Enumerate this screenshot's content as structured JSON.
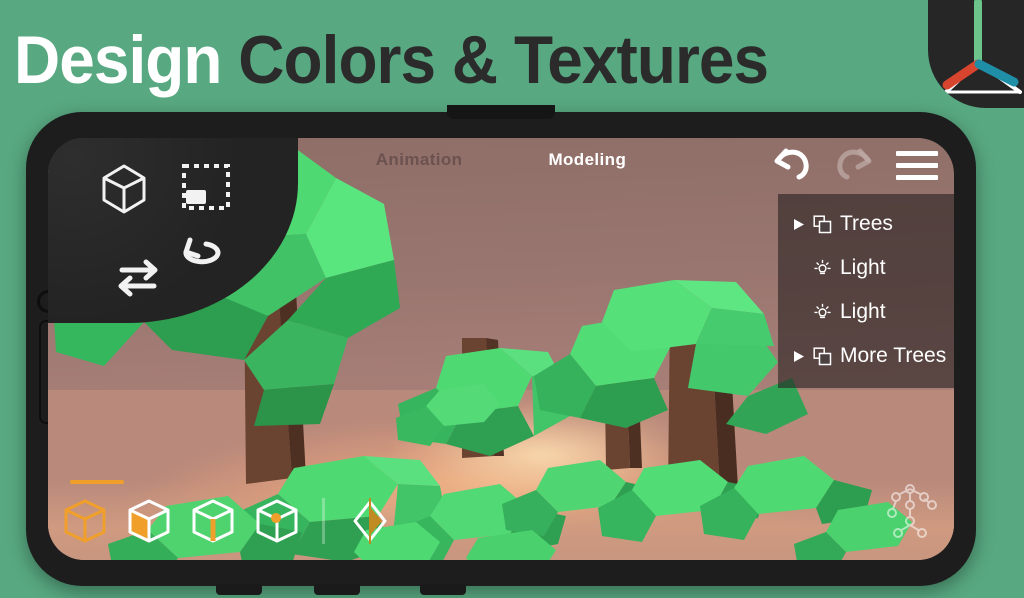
{
  "banner": {
    "title_light": "Design ",
    "title_dark": "Colors & Textures",
    "background_color": "#58a881",
    "title_light_color": "#ffffff",
    "title_dark_color": "#2b2b2b"
  },
  "corner_logo": {
    "name": "axis-gizmo-logo",
    "background_color": "#262626",
    "axis_up_color": "#6cc48a",
    "axis_left_color": "#d8452e",
    "axis_right_color": "#1f8fa8"
  },
  "app": {
    "viewport_tools": [
      {
        "name": "object-mode-cube-icon",
        "label": "Object"
      },
      {
        "name": "marquee-select-icon",
        "label": "Select"
      },
      {
        "name": "rotate-icon",
        "label": "Rotate"
      },
      {
        "name": "move-icon",
        "label": "Move"
      }
    ],
    "tabs": [
      {
        "label": "Animation",
        "active": false
      },
      {
        "label": "Modeling",
        "active": true
      }
    ],
    "top_right": [
      {
        "name": "undo-icon",
        "label": "Undo",
        "enabled": true
      },
      {
        "name": "redo-icon",
        "label": "Redo",
        "enabled": false
      },
      {
        "name": "menu-icon",
        "label": "Menu",
        "enabled": true
      }
    ],
    "outliner": {
      "items": [
        {
          "label": "Trees",
          "icon": "group-icon",
          "expandable": true
        },
        {
          "label": "Light",
          "icon": "light-bulb-icon",
          "expandable": false
        },
        {
          "label": "Light",
          "icon": "light-bulb-icon",
          "expandable": false
        },
        {
          "label": "More Trees",
          "icon": "group-icon",
          "expandable": true
        }
      ],
      "panel_color": "rgba(38,32,32,0.60)"
    },
    "bottom_bar": {
      "accent_color": "#f0a02a",
      "modes": [
        {
          "name": "mode-object",
          "label": "Object",
          "active": true
        },
        {
          "name": "mode-face",
          "label": "Face",
          "active": false
        },
        {
          "name": "mode-edge",
          "label": "Edge",
          "active": false
        },
        {
          "name": "mode-vertex",
          "label": "Vertex",
          "active": false
        }
      ],
      "extra_tool": {
        "name": "shape-gizmo-icon",
        "label": "Shape"
      },
      "rig_tool": {
        "name": "armature-icon",
        "label": "Rig"
      }
    },
    "scene": {
      "sky_color": "#a07a72",
      "ground_color": "#f2b282",
      "foliage_color": "#3ecc5f",
      "trunk_color": "#6b4431"
    }
  }
}
